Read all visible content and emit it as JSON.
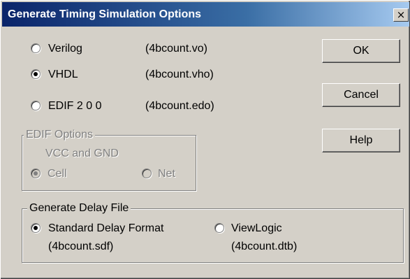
{
  "dialog": {
    "title": "Generate Timing Simulation Options",
    "close_glyph": "×"
  },
  "format_options": [
    {
      "label": "Verilog",
      "file": "(4bcount.vo)",
      "selected": false
    },
    {
      "label": "VHDL",
      "file": "(4bcount.vho)",
      "selected": true
    },
    {
      "label": "EDIF 2 0 0",
      "file": "(4bcount.edo)",
      "selected": false
    }
  ],
  "buttons": {
    "ok": "OK",
    "cancel": "Cancel",
    "help": "Help"
  },
  "edif_options": {
    "title": "EDIF Options",
    "subtitle": "VCC and GND",
    "cell": "Cell",
    "net": "Net",
    "enabled": false,
    "selected": "Cell"
  },
  "delay_file": {
    "title": "Generate Delay File",
    "options": [
      {
        "label": "Standard Delay Format",
        "file": "(4bcount.sdf)",
        "selected": true
      },
      {
        "label": "ViewLogic",
        "file": "(4bcount.dtb)",
        "selected": false
      }
    ]
  },
  "colors": {
    "face": "#d4d0c8",
    "title_start": "#0a246a",
    "title_end": "#a6caf0",
    "disabled_text": "#808080"
  }
}
